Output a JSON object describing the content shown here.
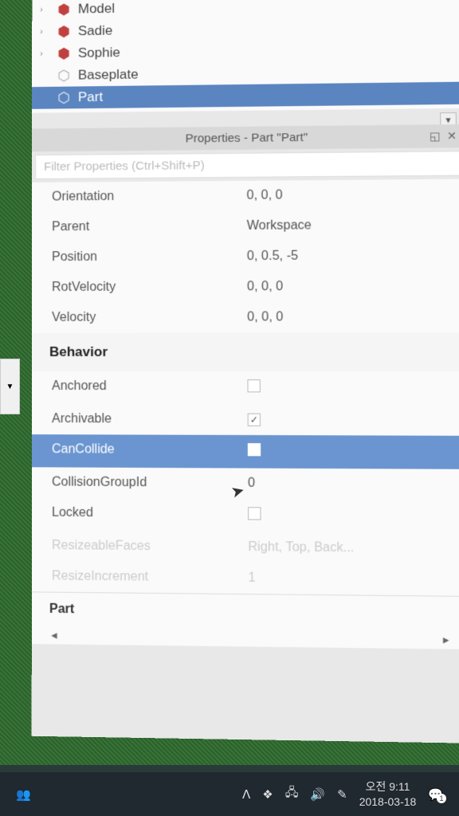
{
  "explorer": {
    "items": [
      {
        "label": "Model",
        "hasChildren": true,
        "icon": "red"
      },
      {
        "label": "Sadie",
        "hasChildren": true,
        "icon": "red"
      },
      {
        "label": "Sophie",
        "hasChildren": true,
        "icon": "red"
      },
      {
        "label": "Baseplate",
        "hasChildren": false,
        "icon": "gray"
      },
      {
        "label": "Part",
        "hasChildren": false,
        "icon": "gray",
        "selected": true
      }
    ]
  },
  "properties": {
    "title": "Properties - Part \"Part\"",
    "filterPlaceholder": "Filter Properties (Ctrl+Shift+P)",
    "rows": [
      {
        "label": "Orientation",
        "value": "0, 0, 0"
      },
      {
        "label": "Parent",
        "value": "Workspace"
      },
      {
        "label": "Position",
        "value": "0, 0.5, -5"
      },
      {
        "label": "RotVelocity",
        "value": "0, 0, 0"
      },
      {
        "label": "Velocity",
        "value": "0, 0, 0"
      }
    ],
    "behaviorSection": "Behavior",
    "behaviorRows": [
      {
        "label": "Anchored",
        "checked": false
      },
      {
        "label": "Archivable",
        "checked": true
      },
      {
        "label": "CanCollide",
        "checked": false,
        "selected": true
      },
      {
        "label": "CollisionGroupId",
        "value": "0"
      },
      {
        "label": "Locked",
        "checked": false
      },
      {
        "label": "ResizeableFaces",
        "value": "Right, Top, Back...",
        "faded": true
      },
      {
        "label": "ResizeIncrement",
        "value": "1",
        "faded": true
      }
    ],
    "bottomLabel": "Part"
  },
  "taskbar": {
    "time": "오전 9:11",
    "date": "2018-03-18",
    "notifCount": "1"
  }
}
